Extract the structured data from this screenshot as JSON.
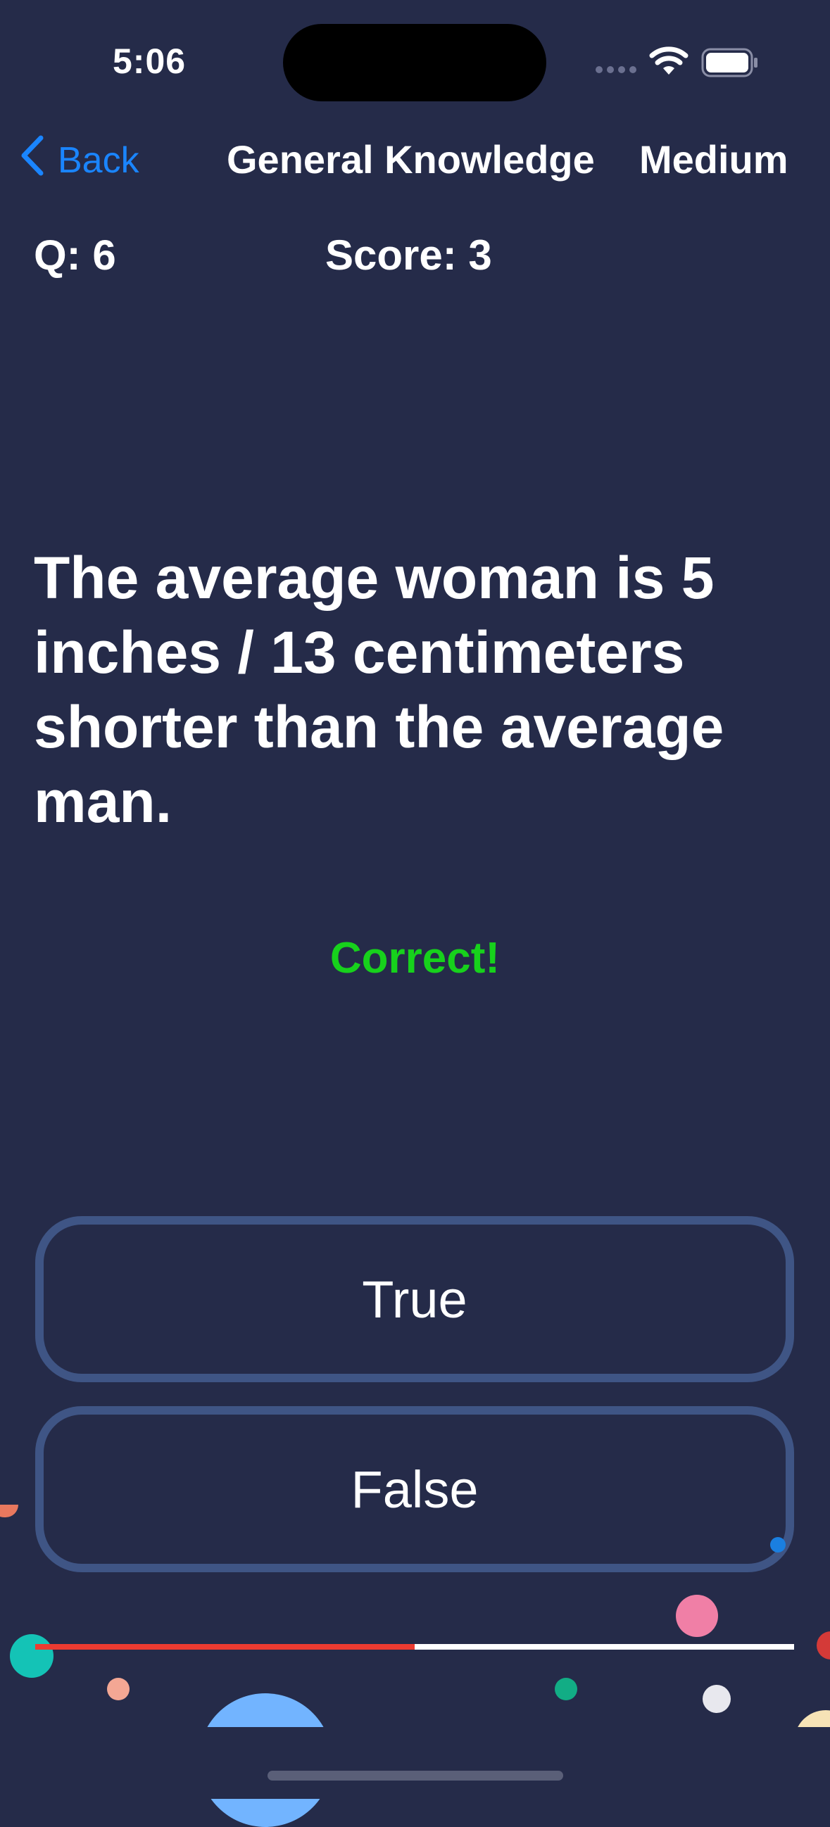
{
  "status_bar": {
    "time": "5:06",
    "icons": [
      "cellular-dots-icon",
      "wifi-icon",
      "battery-icon"
    ]
  },
  "nav": {
    "back_label": "Back",
    "title": "General Knowledge",
    "difficulty": "Medium"
  },
  "quiz": {
    "question_number": "Q: 6",
    "score": "Score: 3",
    "question": "The average woman is 5 inches / 13 centimeters shorter than the average man.",
    "feedback": "Correct!",
    "answers": [
      "True",
      "False"
    ],
    "progress": 0.5
  },
  "colors": {
    "background": "#252b49",
    "accent": "#1a85ff",
    "correct": "#17d11c",
    "button_border": "#3f5585",
    "progress_fill": "#ec3b31",
    "progress_track": "#ffffff"
  }
}
